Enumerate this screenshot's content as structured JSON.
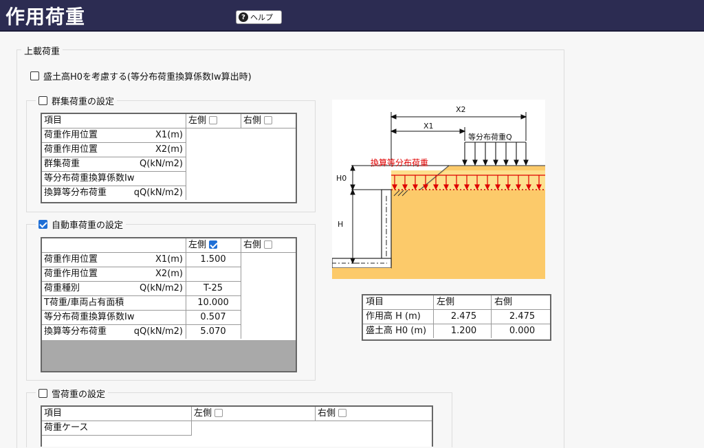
{
  "header": {
    "title": "作用荷重",
    "help_label": "ヘルプ",
    "help_icon": "question-circle-icon"
  },
  "surcharge": {
    "legend": "上載荷重",
    "consider_fill_label": "盛土高H0を考慮する(等分布荷重換算係数Iw算出時)",
    "consider_fill_checked": false
  },
  "crowd": {
    "legend": "群集荷重の設定",
    "checked": false,
    "headers": {
      "item": "項目",
      "left": "左側",
      "right": "右側"
    },
    "rows": [
      {
        "label": "荷重作用位置",
        "unit": "X1(m)"
      },
      {
        "label": "荷重作用位置",
        "unit": "X2(m)"
      },
      {
        "label": "群集荷重",
        "unit": "Q(kN/m2)"
      },
      {
        "label": "等分布荷重換算係数Iw",
        "unit": ""
      },
      {
        "label": "換算等分布荷重",
        "unit": "qQ(kN/m2)"
      }
    ]
  },
  "vehicle": {
    "legend": "自動車荷重の設定",
    "checked": true,
    "headers": {
      "left": "左側",
      "right": "右側"
    },
    "rows": [
      {
        "label": "荷重作用位置",
        "unit": "X1(m)",
        "left": "1.500"
      },
      {
        "label": "荷重作用位置",
        "unit": "X2(m)",
        "left": ""
      },
      {
        "label": "荷重種別",
        "unit": "Q(kN/m2)",
        "left": "T-25"
      },
      {
        "label": "T荷重/車両占有面積",
        "unit": "",
        "left": "10.000"
      },
      {
        "label": "等分布荷重換算係数Iw",
        "unit": "",
        "left": "0.507"
      },
      {
        "label": "換算等分布荷重",
        "unit": "qQ(kN/m2)",
        "left": "5.070"
      }
    ]
  },
  "snow": {
    "legend": "雪荷重の設定",
    "checked": false,
    "headers": {
      "item": "項目",
      "left": "左側",
      "right": "右側"
    },
    "rows": [
      {
        "label": "荷重ケース"
      }
    ]
  },
  "diagram": {
    "x2": "X2",
    "x1": "X1",
    "uniform_load": "等分布荷重Q",
    "converted_load": "換算等分布荷重",
    "h0": "H0",
    "h": "H"
  },
  "results": {
    "headers": {
      "item": "項目",
      "left": "左側",
      "right": "右側"
    },
    "rows": [
      {
        "label": "作用高 H (m)",
        "left": "2.475",
        "right": "2.475"
      },
      {
        "label": "盛土高 H0 (m)",
        "left": "1.200",
        "right": "0.000"
      }
    ]
  },
  "colors": {
    "title_bar": "#2c2c52",
    "checkbox_accent": "#1f6fd6",
    "soil": "#fcca6a",
    "load_arrow": "#e00000"
  }
}
